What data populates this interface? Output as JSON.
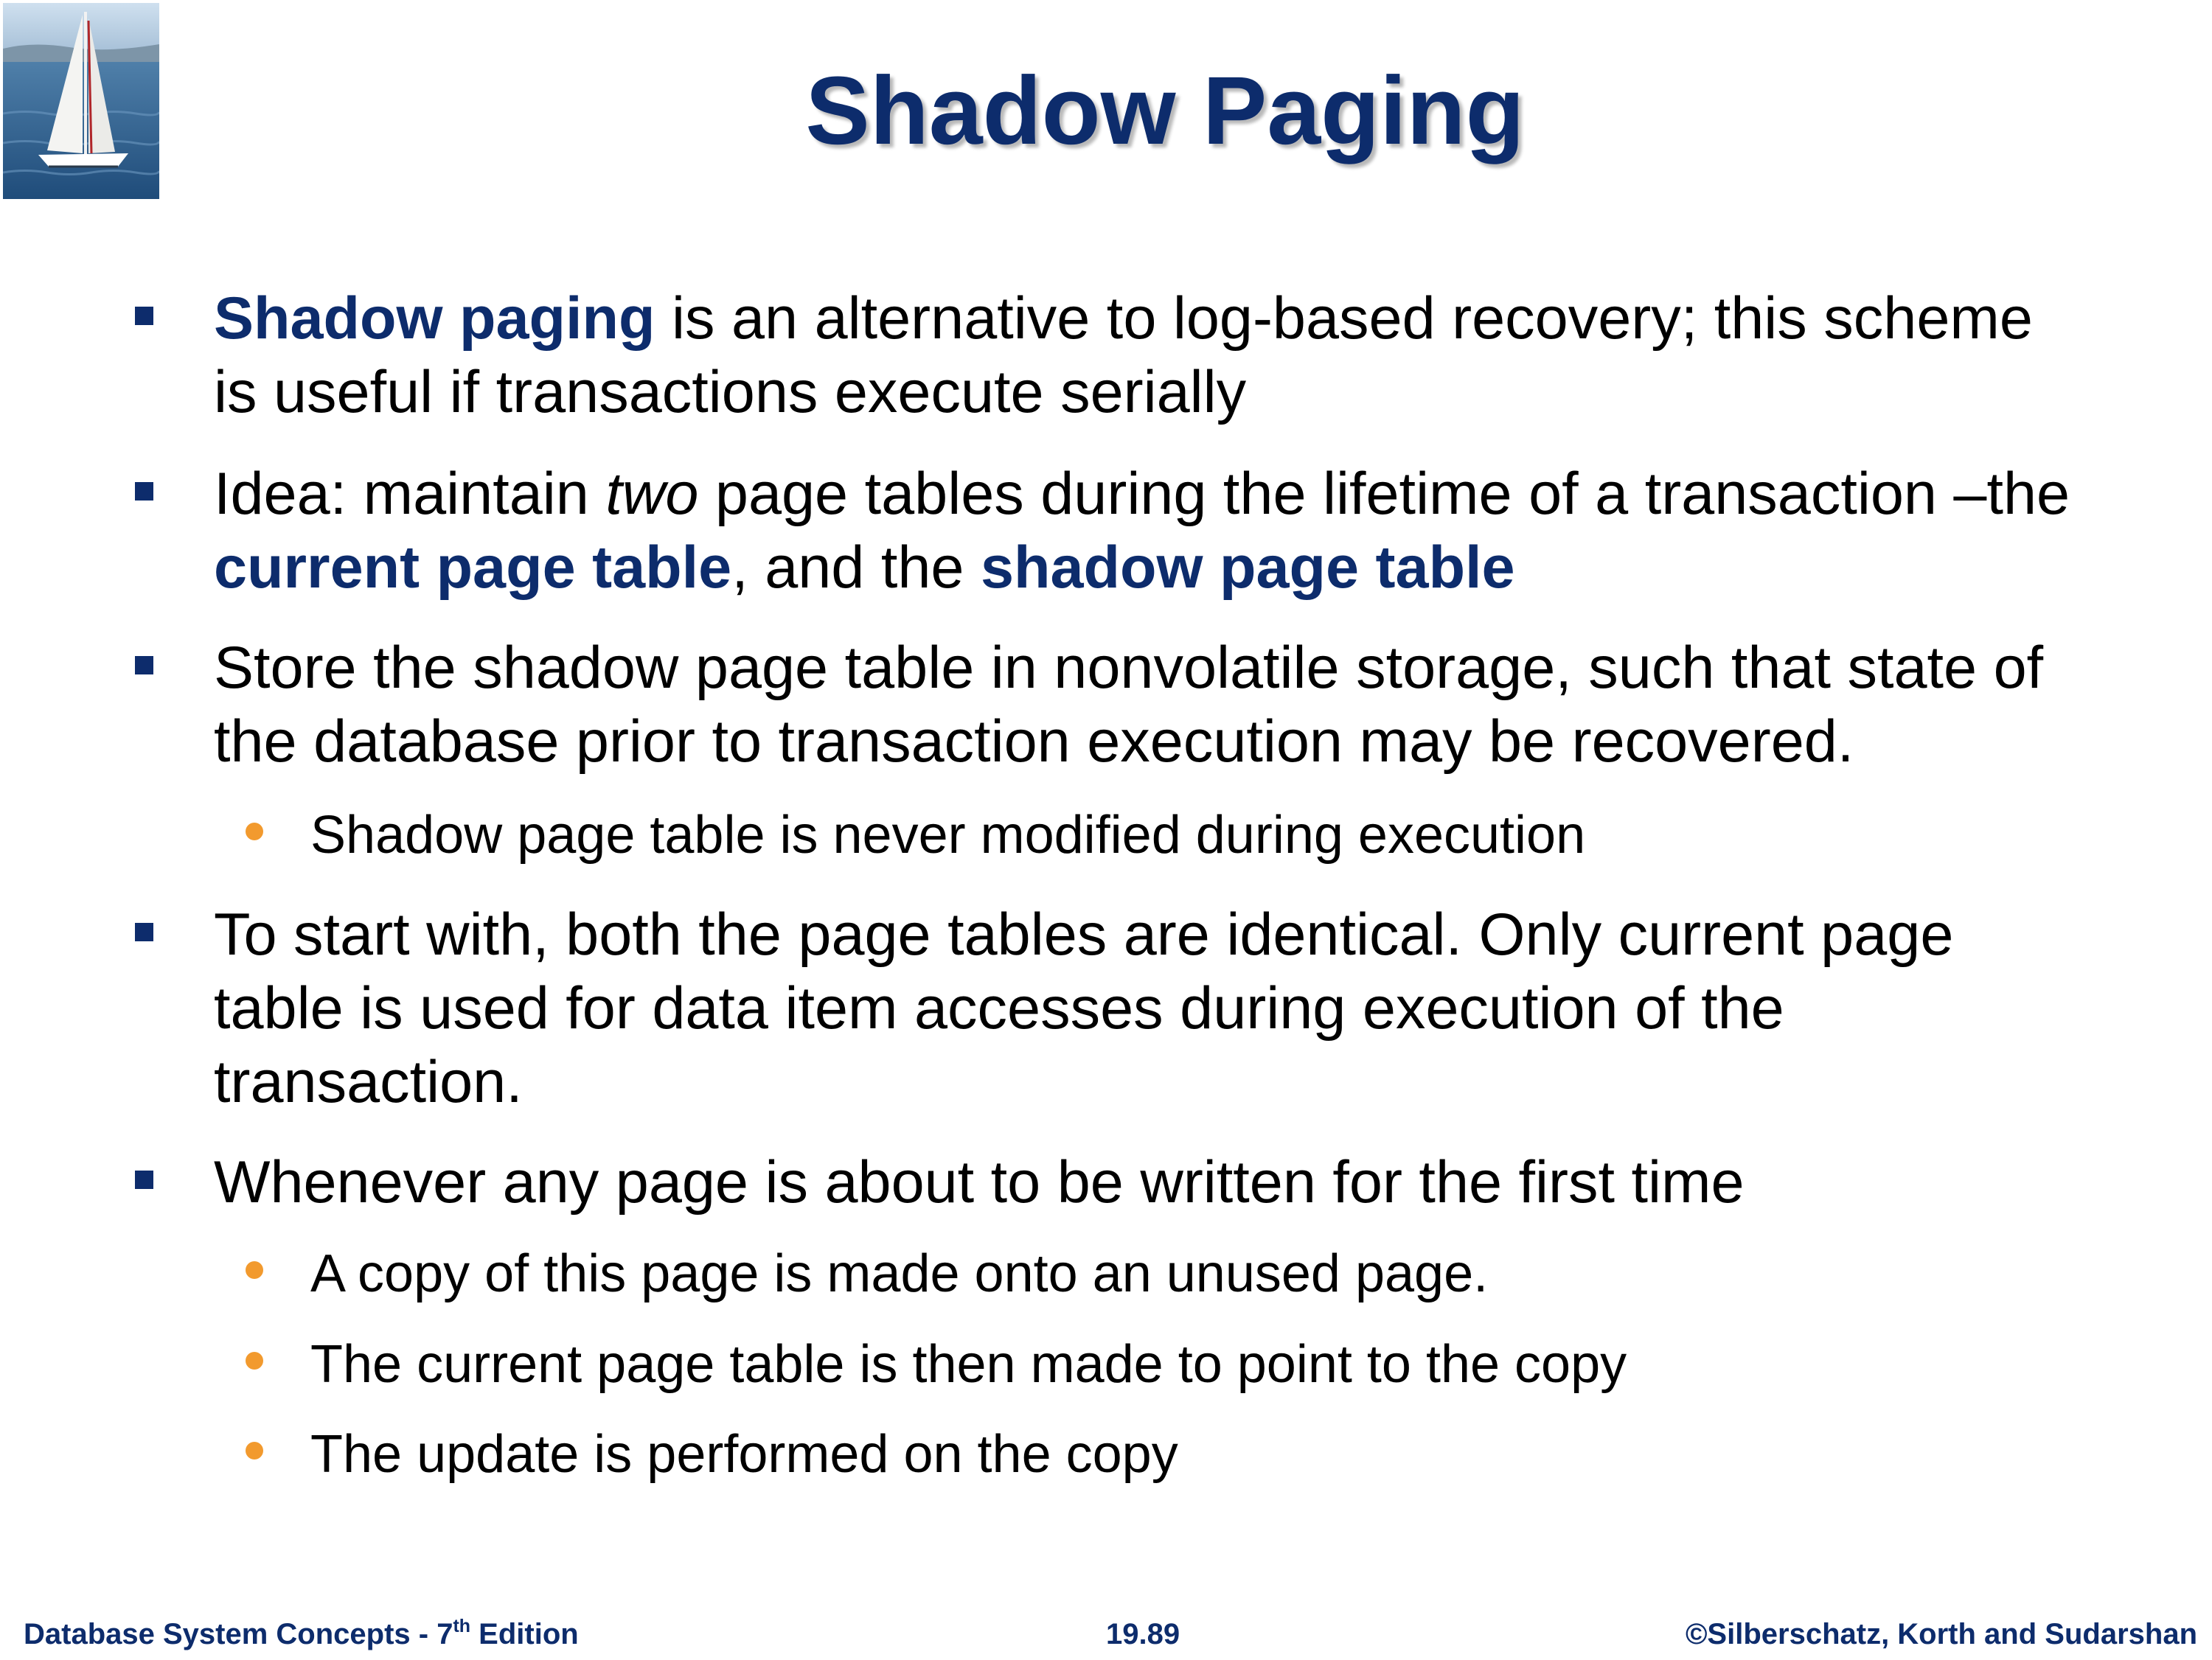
{
  "slide": {
    "title": "Shadow Paging",
    "logo": {
      "icon": "sailboat-photo"
    },
    "colors": {
      "accent": "#0d2c6c",
      "sub_bullet": "#f29a2e"
    },
    "bullets": [
      {
        "level": 1,
        "lines": [
          {
            "highlight": "Shadow paging",
            "text": " is an alternative to log-based recovery; this scheme"
          },
          {
            "text": "is useful if  transactions execute serially"
          }
        ]
      },
      {
        "level": 1,
        "lines": [
          {
            "text_before": "Idea: maintain ",
            "italic": "two",
            "text_after": " page tables during the lifetime of a transaction –the"
          },
          {
            "highlight": "current page table",
            "text_mid": ", and the ",
            "highlight2": "shadow page table"
          }
        ]
      },
      {
        "level": 1,
        "lines": [
          {
            "text": "Store the shadow page table in nonvolatile storage, such that state of"
          },
          {
            "text": "the database prior to transaction execution may be recovered."
          }
        ]
      },
      {
        "level": 2,
        "lines": [
          {
            "text": "Shadow page table is never modified during execution"
          }
        ]
      },
      {
        "level": 1,
        "lines": [
          {
            "text": "To start with, both the page tables are identical. Only current page"
          },
          {
            "text": "table is used for data item accesses during execution of the"
          },
          {
            "text": "transaction."
          }
        ]
      },
      {
        "level": 1,
        "lines": [
          {
            "text": "Whenever any page is about to be written for the first time"
          }
        ]
      },
      {
        "level": 2,
        "lines": [
          {
            "text": "A copy of this page is made onto an unused page."
          }
        ]
      },
      {
        "level": 2,
        "lines": [
          {
            "text": "The current page table is then made to point to the copy"
          }
        ]
      },
      {
        "level": 2,
        "lines": [
          {
            "text": "The update is performed on the copy"
          }
        ]
      }
    ]
  },
  "footer": {
    "left_prefix": "Database System Concepts - 7",
    "left_sup": "th",
    "left_suffix": " Edition",
    "page_number": "19.89",
    "copyright": "©Silberschatz, Korth and Sudarshan"
  }
}
